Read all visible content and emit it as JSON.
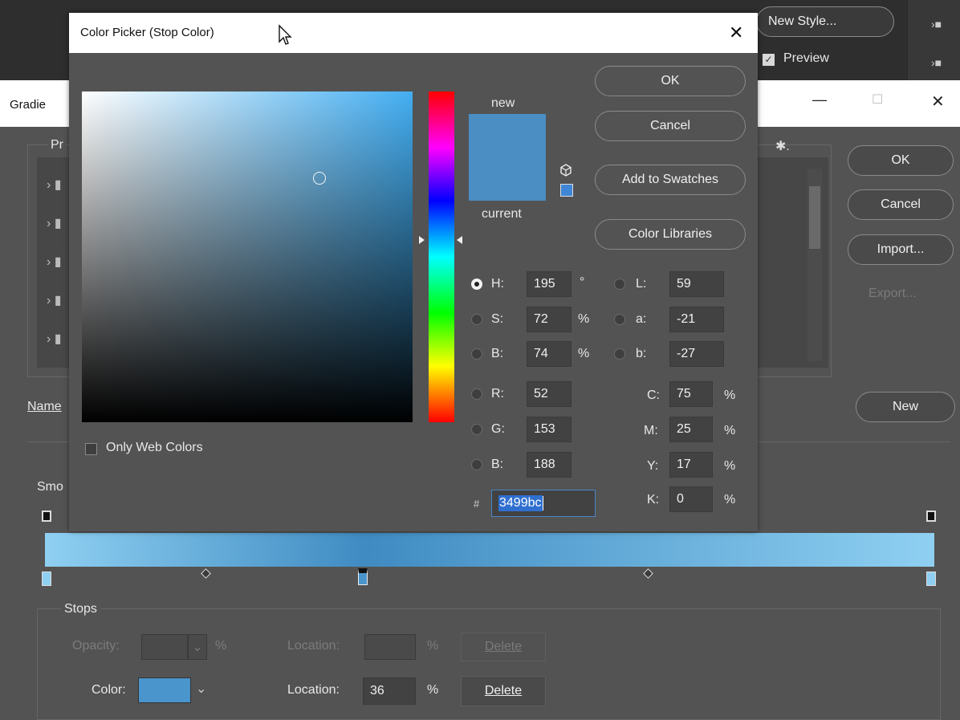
{
  "bg_window": {
    "new_style_label": "New Style...",
    "preview_label": "Preview",
    "preview_checked": true
  },
  "gradient_editor": {
    "title_partial": "Gradie",
    "minimize_glyph": "—",
    "maximize_glyph": "☐",
    "close_glyph": "✕",
    "presets_label_partial": "Pr",
    "ok_label": "OK",
    "cancel_label": "Cancel",
    "import_label": "Import...",
    "export_label": "Export...",
    "name_label_partial": "Name",
    "new_label": "New",
    "smoothness_partial": "Smo",
    "stops_label": "Stops",
    "opacity_label": "Opacity:",
    "opacity_unit": "%",
    "opacity_location_label": "Location:",
    "opacity_location_unit": "%",
    "opacity_delete_label": "Delete",
    "color_label": "Color:",
    "color_swatch": "#4a95cb",
    "color_location_label": "Location:",
    "color_location_value": "36",
    "color_location_unit": "%",
    "color_delete_label": "Delete",
    "gradient_colors": [
      "#8fd0f2",
      "#3f8bc2",
      "#8fd0f2"
    ],
    "color_stop_location": 36
  },
  "color_picker": {
    "title": "Color Picker (Stop Color)",
    "close_glyph": "✕",
    "new_label": "new",
    "current_label": "current",
    "new_color": "#4a8ec4",
    "current_color": "#4a8ec4",
    "ok_label": "OK",
    "cancel_label": "Cancel",
    "add_swatches_label": "Add to Swatches",
    "color_libraries_label": "Color Libraries",
    "only_web_colors_label": "Only Web Colors",
    "hue_color": "#43aef2",
    "hsb": [
      {
        "label": "H:",
        "value": "195",
        "unit": "°",
        "selected": true
      },
      {
        "label": "S:",
        "value": "72",
        "unit": "%",
        "selected": false
      },
      {
        "label": "B:",
        "value": "74",
        "unit": "%",
        "selected": false
      }
    ],
    "rgb": [
      {
        "label": "R:",
        "value": "52"
      },
      {
        "label": "G:",
        "value": "153"
      },
      {
        "label": "B:",
        "value": "188"
      }
    ],
    "lab": [
      {
        "label": "L:",
        "value": "59"
      },
      {
        "label": "a:",
        "value": "-21"
      },
      {
        "label": "b:",
        "value": "-27"
      }
    ],
    "cmyk": [
      {
        "label": "C:",
        "value": "75",
        "unit": "%"
      },
      {
        "label": "M:",
        "value": "25",
        "unit": "%"
      },
      {
        "label": "Y:",
        "value": "17",
        "unit": "%"
      },
      {
        "label": "K:",
        "value": "0",
        "unit": "%"
      }
    ],
    "hex_label": "#",
    "hex_value": "3499bc"
  }
}
